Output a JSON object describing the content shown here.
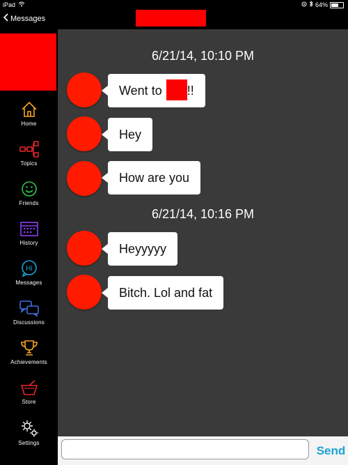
{
  "status_bar": {
    "device": "iPad",
    "battery": "64%",
    "battery_level": 0.64
  },
  "nav": {
    "back_label": "Messages"
  },
  "sidebar": {
    "items": [
      {
        "label": "Home",
        "icon": "home-icon",
        "color": "#f5a623"
      },
      {
        "label": "Topics",
        "icon": "topics-icon",
        "color": "#e8262d"
      },
      {
        "label": "Friends",
        "icon": "friends-icon",
        "color": "#33c24d"
      },
      {
        "label": "History",
        "icon": "history-icon",
        "color": "#8a3cf0"
      },
      {
        "label": "Messages",
        "icon": "messages-icon",
        "color": "#1aa3d6"
      },
      {
        "label": "Discussions",
        "icon": "discussions-icon",
        "color": "#3d6fe0"
      },
      {
        "label": "Achievements",
        "icon": "trophy-icon",
        "color": "#f5a623"
      },
      {
        "label": "Store",
        "icon": "store-icon",
        "color": "#e8262d"
      },
      {
        "label": "Settings",
        "icon": "gear-icon",
        "color": "#ffffff"
      }
    ]
  },
  "chat": {
    "timestamps": [
      "6/21/14, 10:10 PM",
      "6/21/14, 10:16 PM"
    ],
    "messages": [
      {
        "text_before": "Went to",
        "text_after": "!!"
      },
      {
        "text": "Hey"
      },
      {
        "text": "How are you"
      },
      {
        "text": "Heyyyyy"
      },
      {
        "text": "Bitch. Lol and fat"
      }
    ]
  },
  "composer": {
    "value": "",
    "placeholder": "",
    "send_label": "Send"
  },
  "colors": {
    "accent": "#1aa3d6",
    "redaction": "#ff0000",
    "avatar": "#ff1a00",
    "chat_bg": "#3a3a3a"
  }
}
